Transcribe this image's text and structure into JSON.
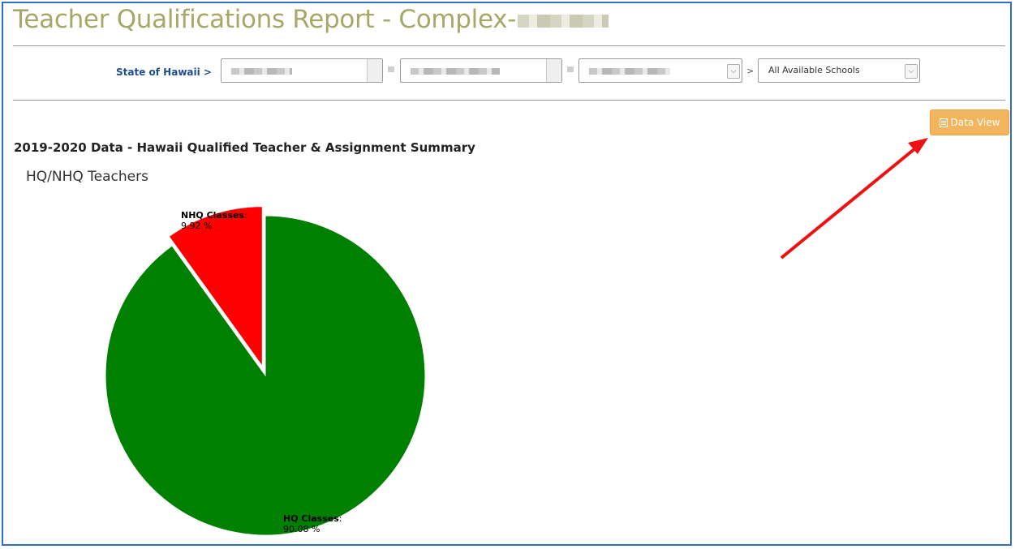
{
  "page": {
    "title": "Teacher Qualifications Report - Complex-"
  },
  "filters": {
    "breadcrumb_root": "State of Hawaii >",
    "separator": ">",
    "school_select_value": "All Available Schools"
  },
  "toolbar": {
    "data_view_label": "Data View",
    "data_view_icon": "list-icon"
  },
  "report": {
    "heading": "2019-2020 Data - Hawaii Qualified Teacher & Assignment Summary"
  },
  "chart_data": {
    "type": "pie",
    "title": "HQ/NHQ Teachers",
    "slices": [
      {
        "label": "HQ Classes",
        "value": 90.08,
        "value_text": "90.08 %",
        "color": "#008000"
      },
      {
        "label": "NHQ Classes",
        "value": 9.92,
        "value_text": "9.92 %",
        "color": "#ff0000"
      }
    ]
  },
  "annotation": {
    "arrow_color": "#ee1111"
  }
}
